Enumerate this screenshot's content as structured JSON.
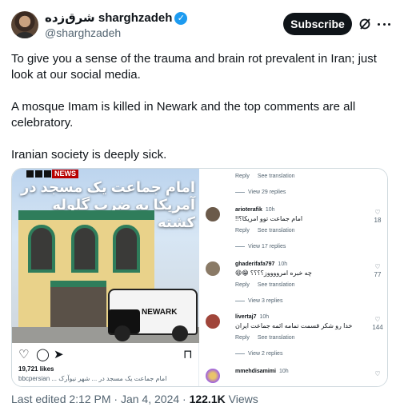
{
  "author": {
    "display_name": "شرق‌زده sharghzadeh",
    "handle": "@sharghzadeh",
    "verified_mark": "✓"
  },
  "header": {
    "subscribe_label": "Subscribe"
  },
  "tweet": {
    "paragraphs": [
      "To give you a sense of the trauma and brain rot prevalent in Iran; just look at our social media.",
      "A mosque Imam is killed in Newark and the top comments are all celebratory.",
      "Iranian society is deeply sick."
    ]
  },
  "media": {
    "headline_fa": "امام جماعت یک مسجد در آمریکا به ضرب گلوله کشته شد",
    "bbc_label": "NEWS",
    "car_label": "NEWARK",
    "likes": "19,721 likes",
    "caption": "bbcpersian ... امام جماعت یک مسجد در ... شهر نیوآرک",
    "comments": [
      {
        "meta": [
          "Reply",
          "See translation"
        ],
        "view": "View 29 replies"
      },
      {
        "user": "arioterafik",
        "time": "10h",
        "text": "امام جماعت توو امریکا؟!!",
        "likes": "18",
        "meta": [
          "Reply",
          "See translation"
        ],
        "view": "View 17 replies"
      },
      {
        "user": "ghaderifafa797",
        "time": "10h",
        "text": "چه خبره امرووووز؟؟؟؟ 😁😆",
        "likes": "77",
        "meta": [
          "Reply",
          "See translation"
        ],
        "view": "View 3 replies"
      },
      {
        "user": "livertaj7",
        "time": "10h",
        "text": "خدا رو شکر قسمت تمامه ائمه جماعت ایران",
        "likes": "144",
        "meta": [
          "Reply",
          "See translation"
        ],
        "view": "View 2 replies"
      },
      {
        "user": "mmehdisamimi",
        "time": "10h",
        "text": "",
        "likes": ""
      }
    ]
  },
  "footer": {
    "edited": "Last edited 2:12 PM · Jan 4, 2024 · ",
    "views": "122.1K",
    "views_label": " Views"
  },
  "colors": {
    "subscribe_bg": "#0f1419",
    "verified": "#1d9bf0",
    "muted_text": "#536471"
  }
}
